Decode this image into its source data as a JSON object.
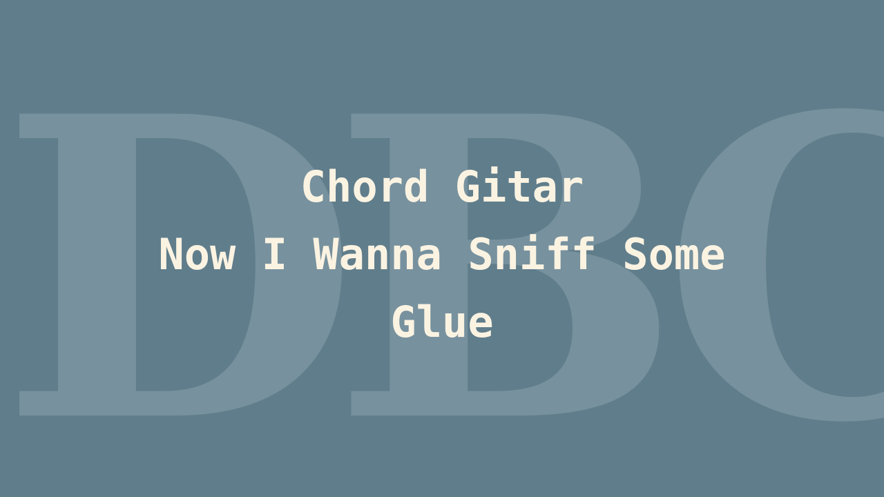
{
  "watermark": {
    "text": "DBC"
  },
  "title": {
    "line1": "Chord Gitar",
    "line2": "Now I Wanna Sniff Some",
    "line3": "Glue"
  },
  "colors": {
    "background": "#607d8b",
    "title_text": "#fbf3e2",
    "watermark": "#a8bcc8"
  }
}
